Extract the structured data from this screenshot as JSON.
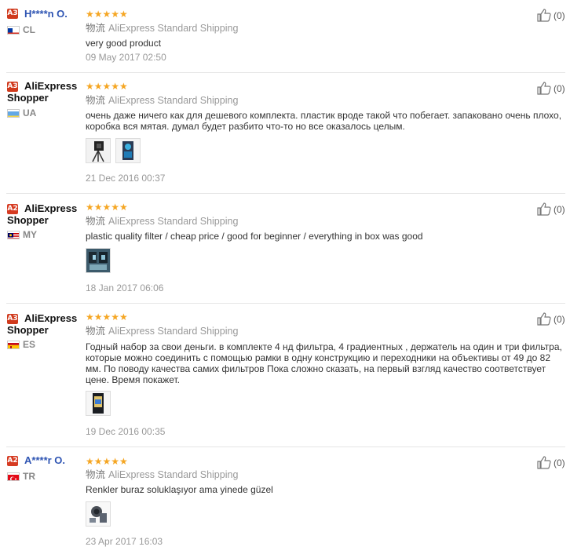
{
  "shipping_label": "物流",
  "stars": "★★★★★",
  "reviews": [
    {
      "badge": "A3",
      "user": "H****n O.",
      "country": "CL",
      "rating": 5,
      "shipping": "AliExpress Standard Shipping",
      "text": "very good product",
      "date": "09 May 2017 02:50",
      "likes": "(0)",
      "photos": 0
    },
    {
      "badge": "A3",
      "user_line1": "AliExpress",
      "user_line2": "Shopper",
      "country": "UA",
      "rating": 5,
      "shipping": "AliExpress Standard Shipping",
      "text": "очень даже ничего как для дешевого комплекта. пластик вроде такой что побегает. запаковано очень плохо, коробка вся мятая. думал будет разбито что-то но все оказалось целым.",
      "date": "21 Dec 2016 00:37",
      "likes": "(0)",
      "photos": 2
    },
    {
      "badge": "A2",
      "user_line1": "AliExpress",
      "user_line2": "Shopper",
      "country": "MY",
      "rating": 5,
      "shipping": "AliExpress Standard Shipping",
      "text": "plastic quality filter / cheap price / good for beginner / everything in box was good",
      "date": "18 Jan 2017 06:06",
      "likes": "(0)",
      "photos": 1
    },
    {
      "badge": "A3",
      "user_line1": "AliExpress",
      "user_line2": "Shopper",
      "country": "ES",
      "rating": 5,
      "shipping": "AliExpress Standard Shipping",
      "text": "Годный набор за свои деньги. в комплекте 4 нд фильтра, 4 градиентных , держатель на один и три фильтра, которые можно соединить с помощью рамки в одну конструкцию и переходники на объективы от 49 до 82 мм. По поводу качества самих фильтров Пока сложно сказать, на первый взгляд качество соответствует цене. Время покажет.",
      "date": "19 Dec 2016 00:35",
      "likes": "(0)",
      "photos": 1
    },
    {
      "badge": "A2",
      "user": "A****r O.",
      "country": "TR",
      "rating": 5,
      "shipping": "AliExpress Standard Shipping",
      "text": "Renkler buraz soluklaşıyor ama yinede güzel",
      "date": "23 Apr 2017 16:03",
      "likes": "(0)",
      "photos": 1
    }
  ]
}
